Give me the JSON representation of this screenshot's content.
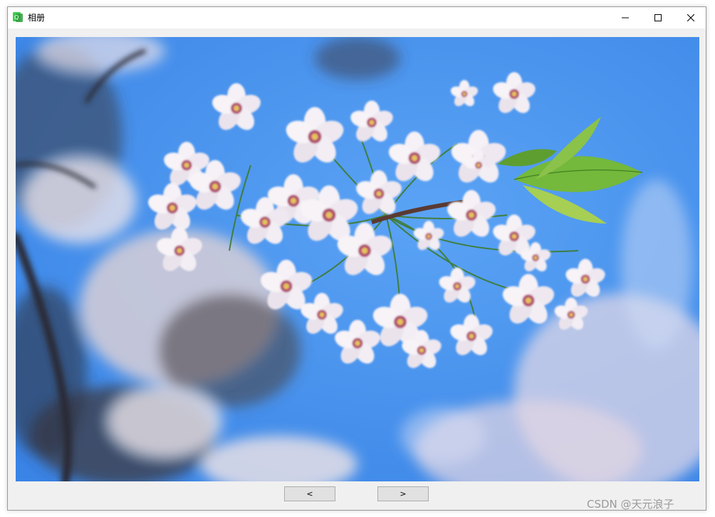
{
  "window": {
    "title": "相册",
    "icon": "qt-app-icon"
  },
  "titlebar": {
    "minimize_icon": "minimize-icon",
    "maximize_icon": "maximize-icon",
    "close_icon": "close-icon"
  },
  "viewer": {
    "image_subject": "cherry-blossom-photo"
  },
  "nav": {
    "prev_label": "<",
    "next_label": ">"
  },
  "watermark": {
    "text": "CSDN @天元浪子"
  },
  "colors": {
    "sky": "#4690ee",
    "blossom": "#f4eef3",
    "leaf": "#6fb13a"
  }
}
